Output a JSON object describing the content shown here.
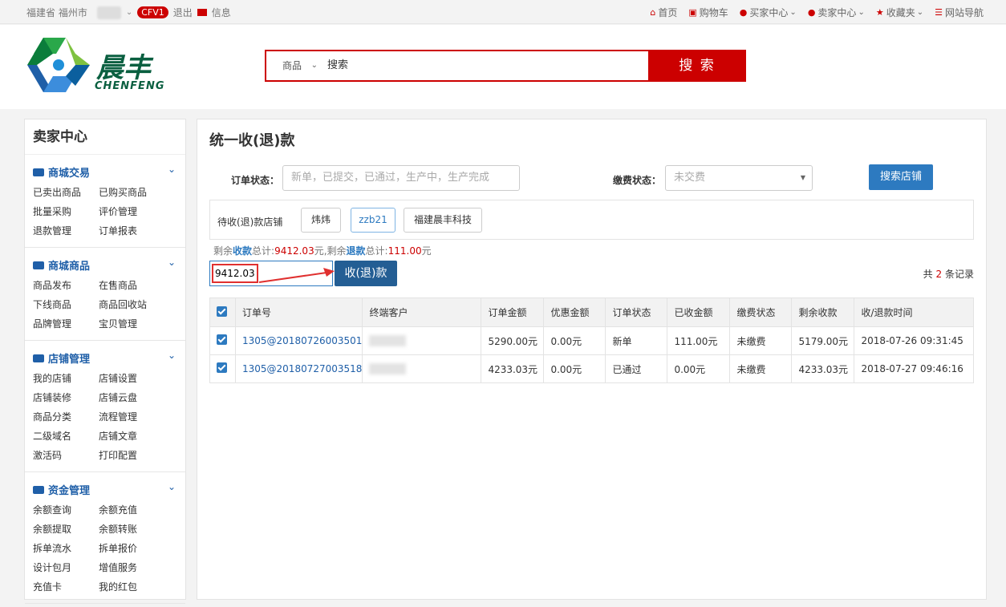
{
  "topbar": {
    "location": "福建省 福州市",
    "badge": "CFV1",
    "logout": "退出",
    "messages": "信息",
    "nav": [
      {
        "icon": "home-icon",
        "label": "首页"
      },
      {
        "icon": "cart-icon",
        "label": "购物车"
      },
      {
        "icon": "user-icon",
        "label": "买家中心"
      },
      {
        "icon": "user-icon",
        "label": "卖家中心"
      },
      {
        "icon": "star-icon",
        "label": "收藏夹"
      },
      {
        "icon": "list-icon",
        "label": "网站导航"
      }
    ]
  },
  "header": {
    "logo_cn": "晨丰",
    "logo_en": "CHENFENG",
    "search_category": "商品",
    "search_value": "搜索",
    "search_button": "搜 索"
  },
  "sidebar": {
    "title": "卖家中心",
    "sections": [
      {
        "title": "商城交易",
        "icon": "card-icon",
        "links": [
          "已卖出商品",
          "已购买商品",
          "批量采购",
          "评价管理",
          "退款管理",
          "订单报表"
        ]
      },
      {
        "title": "商城商品",
        "icon": "truck-icon",
        "links": [
          "商品发布",
          "在售商品",
          "下线商品",
          "商品回收站",
          "品牌管理",
          "宝贝管理"
        ]
      },
      {
        "title": "店铺管理",
        "icon": "home-icon",
        "links": [
          "我的店铺",
          "店铺设置",
          "店铺装修",
          "店铺云盘",
          "商品分类",
          "流程管理",
          "二级域名",
          "店铺文章",
          "激活码",
          "打印配置"
        ]
      },
      {
        "title": "资金管理",
        "icon": "money-icon",
        "links": [
          "余额查询",
          "余额充值",
          "余额提取",
          "余额转账",
          "拆单流水",
          "拆单报价",
          "设计包月",
          "增值服务",
          "充值卡",
          "我的红包"
        ]
      }
    ]
  },
  "main": {
    "title": "统一收(退)款",
    "order_status_label": "订单状态：",
    "order_status_placeholder": "新单，已提交，已通过，生产中，生产完成",
    "pay_status_label": "缴费状态：",
    "pay_status_value": "未交费",
    "search_shop_button": "搜索店铺",
    "shops_label": "待收(退)款店铺",
    "shops": [
      "炜炜",
      "zzb21",
      "福建晨丰科技"
    ],
    "summary": {
      "prefix": "剩余",
      "collect_word": "收款",
      "collect_mid": "总计:",
      "collect_total": "9412.03",
      "collect_unit": "元,剩余",
      "refund_word": "退款",
      "refund_mid": "总计:",
      "refund_total": "111.00",
      "refund_unit": "元"
    },
    "amount_value": "9412.03",
    "collect_button": "收(退)款",
    "records_prefix": "共",
    "records_count": "2",
    "records_suffix": "条记录"
  },
  "table": {
    "headers": [
      "订单号",
      "终端客户",
      "订单金额",
      "优惠金额",
      "订单状态",
      "已收金额",
      "缴费状态",
      "剩余收款",
      "收/退款时间"
    ],
    "rows": [
      {
        "order_no": "1305@20180726003501",
        "amount": "5290.00元",
        "discount": "0.00元",
        "status": "新单",
        "received": "111.00元",
        "pay_status": "未缴费",
        "remaining": "5179.00元",
        "time": "2018-07-26 09:31:45"
      },
      {
        "order_no": "1305@20180727003518",
        "amount": "4233.03元",
        "discount": "0.00元",
        "status": "已通过",
        "received": "0.00元",
        "pay_status": "未缴费",
        "remaining": "4233.03元",
        "time": "2018-07-27 09:46:16"
      }
    ]
  },
  "colors": {
    "brand_red": "#cc0000",
    "accent_blue": "#2d7ac0",
    "link_blue": "#1f5fa8",
    "logo_green": "#0a5f40"
  }
}
